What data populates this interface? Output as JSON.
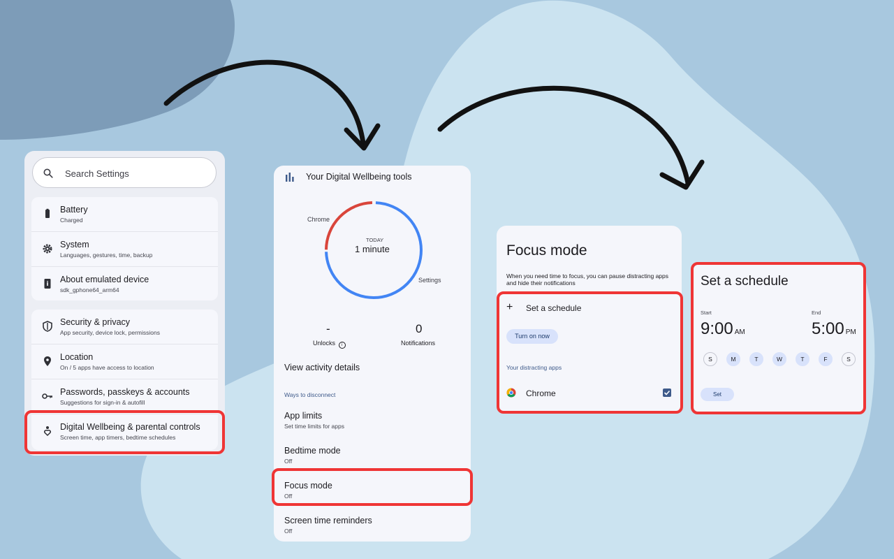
{
  "settings": {
    "search": {
      "placeholder": "Search Settings",
      "icon": "search-icon"
    },
    "group1": [
      {
        "title": "Battery",
        "subtitle": "Charged",
        "icon": "battery-icon"
      },
      {
        "title": "System",
        "subtitle": "Languages, gestures, time, backup",
        "icon": "gear-icon"
      },
      {
        "title": "About emulated device",
        "subtitle": "sdk_gphone64_arm64",
        "icon": "phone-info-icon"
      }
    ],
    "group2": [
      {
        "title": "Security & privacy",
        "subtitle": "App security, device lock, permissions",
        "icon": "shield-icon"
      },
      {
        "title": "Location",
        "subtitle": "On / 5 apps have access to location",
        "icon": "location-pin-icon"
      },
      {
        "title": "Passwords, passkeys & accounts",
        "subtitle": "Suggestions for sign-in & autofill",
        "icon": "key-icon"
      },
      {
        "title": "Digital Wellbeing & parental controls",
        "subtitle": "Screen time, app timers, bedtime schedules",
        "icon": "wellbeing-icon"
      }
    ]
  },
  "wellbeing": {
    "header": "Your Digital Wellbeing tools",
    "donut": {
      "today_label": "TODAY",
      "total": "1 minute",
      "label_chrome": "Chrome",
      "label_settings": "Settings",
      "colors": {
        "chrome": "#d9453b",
        "settings": "#4285f4"
      }
    },
    "unlocks": {
      "value": "-",
      "label": "Unlocks"
    },
    "notifications": {
      "value": "0",
      "label": "Notifications"
    },
    "view_activity": "View activity details",
    "ways_header": "Ways to disconnect",
    "items": [
      {
        "title": "App limits",
        "subtitle": "Set time limits for apps"
      },
      {
        "title": "Bedtime mode",
        "subtitle": "Off"
      },
      {
        "title": "Focus mode",
        "subtitle": "Off"
      },
      {
        "title": "Screen time reminders",
        "subtitle": "Off"
      }
    ]
  },
  "focus_mode": {
    "title": "Focus mode",
    "description": "When you need time to focus, you can pause distracting apps and hide their notifications",
    "set_schedule": "Set a schedule",
    "turn_on_now": "Turn on now",
    "distracting_header": "Your distracting apps",
    "app": {
      "name": "Chrome",
      "checked": true
    }
  },
  "schedule": {
    "title": "Set a schedule",
    "start_label": "Start",
    "end_label": "End",
    "start_time": "9:00",
    "start_ampm": "AM",
    "end_time": "5:00",
    "end_ampm": "PM",
    "days": [
      {
        "letter": "S",
        "selected": false
      },
      {
        "letter": "M",
        "selected": true
      },
      {
        "letter": "T",
        "selected": true
      },
      {
        "letter": "W",
        "selected": true
      },
      {
        "letter": "T",
        "selected": true
      },
      {
        "letter": "F",
        "selected": true
      },
      {
        "letter": "S",
        "selected": false
      }
    ],
    "set_button": "Set"
  },
  "colors": {
    "highlight": "#ef3535",
    "accent": "#3e5a8a",
    "pill": "#d8e2fb"
  }
}
